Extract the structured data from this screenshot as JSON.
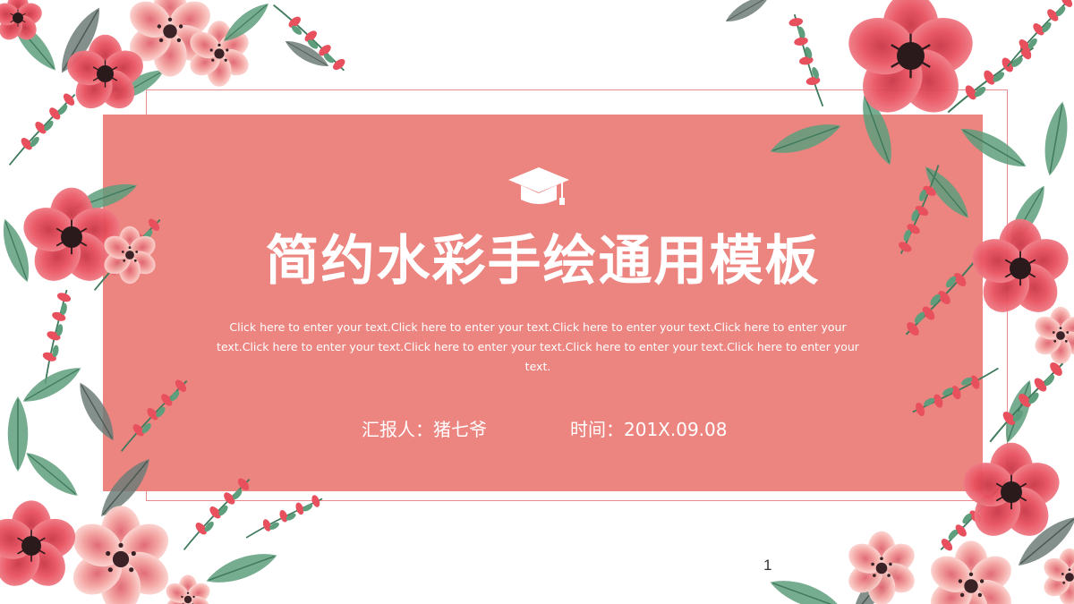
{
  "slide": {
    "title": "简约水彩手绘通用模板",
    "subtitle": "Click here to enter your text.Click here to enter your text.Click here to enter your text.Click here to enter your text.Click here to enter your text.Click here to enter your text.Click here to enter your text.Click here to enter your text.",
    "reporter": "汇报人：猪七爷",
    "date": "时间：201X.09.08",
    "page_number": "1"
  },
  "icons": {
    "header_icon": "graduation-cap-icon"
  },
  "colors": {
    "panel": "#ec8480",
    "frame_line": "#ea8b8e",
    "text": "#ffffff",
    "flower_red": "#e8505e",
    "flower_pink": "#f4a3a0",
    "leaf_green": "#5e9e7c",
    "leaf_grey": "#6f7d78"
  }
}
